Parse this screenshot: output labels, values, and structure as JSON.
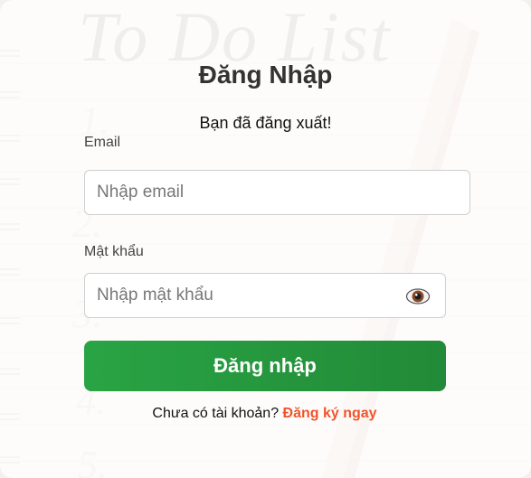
{
  "login": {
    "title": "Đăng Nhập",
    "message": "Bạn đã đăng xuất!",
    "email_label": "Email",
    "email_placeholder": "Nhập email",
    "password_label": "Mật khẩu",
    "password_placeholder": "Nhập mật khẩu",
    "submit_label": "Đăng nhập",
    "footer_text": "Chưa có tài khoản?",
    "register_link": "Đăng ký ngay",
    "password_toggle_icon": "eye-icon",
    "background_text": "To Do List"
  },
  "colors": {
    "primary_button": "#28a745",
    "link": "#f0542c",
    "title": "#333333"
  }
}
